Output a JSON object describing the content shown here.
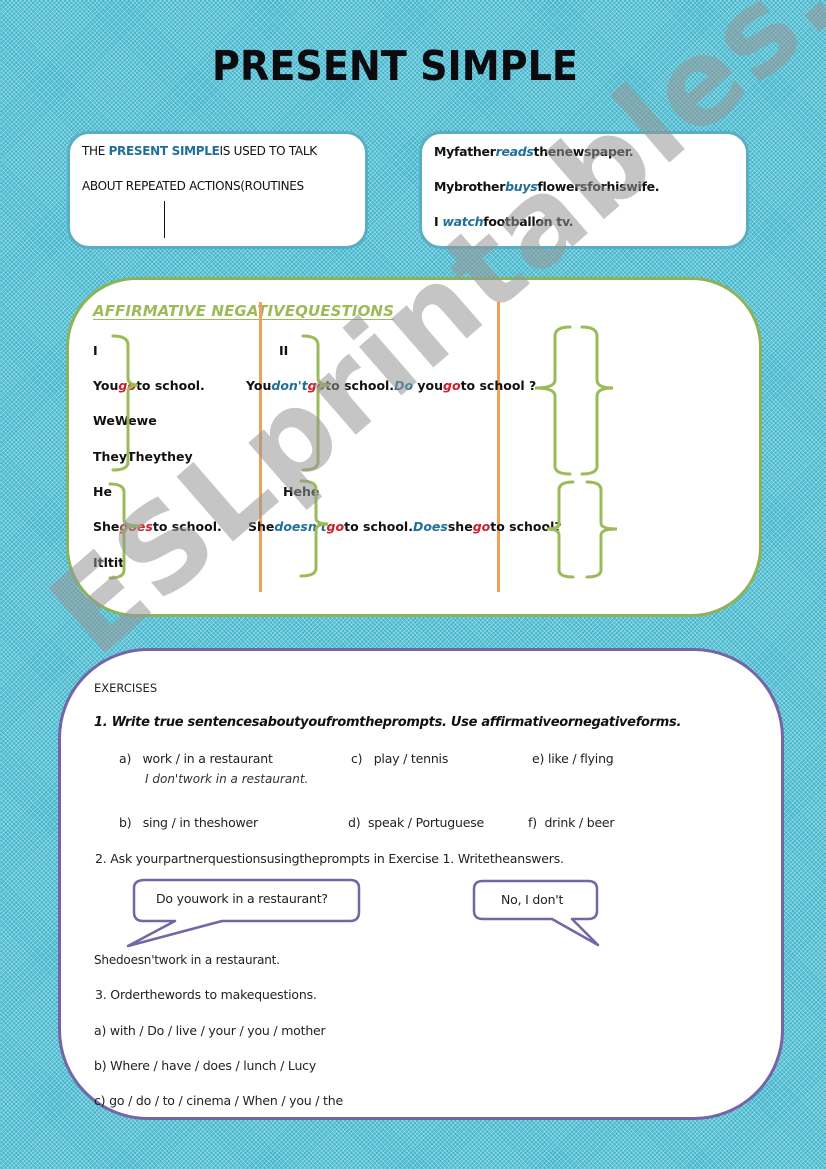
{
  "title": "PRESENT SIMPLE",
  "definition": {
    "prefix": "THE ",
    "highlight": "PRESENT SIMPLE",
    "line1_rest": "IS USED TO TALK",
    "line2": "ABOUT REPEATED ACTIONS(ROUTINES"
  },
  "examples": [
    {
      "before": "Myfather",
      "verb": "reads",
      "after": "thenewspaper."
    },
    {
      "before": "Mybrother",
      "verb": "buys",
      "after": "flowersforhiswife."
    },
    {
      "before": "I ",
      "verb": "watch",
      "after": "footballon tv."
    }
  ],
  "grammar": {
    "heading": "AFFIRMATIVE NEGATIVEQUESTIONS",
    "group1": {
      "pronouns": [
        "I",
        "WeWewe",
        "TheyTheythey"
      ],
      "neg_pronoun": "II",
      "affirmative": {
        "subject": "You",
        "verb": "go",
        "rest": "to school."
      },
      "negative": {
        "subject": "You",
        "aux": "don't",
        "verb": "go",
        "rest": "to school."
      },
      "question": {
        "aux": "Do",
        "subject": " you",
        "verb": "go",
        "rest": "to school ?"
      }
    },
    "group2": {
      "pronouns": [
        "He",
        "Itltit"
      ],
      "neg_pronoun": "Hehe",
      "affirmative": {
        "subject": "She",
        "verb": "goes",
        "rest": "to school."
      },
      "negative": {
        "subject": "She",
        "aux": "doesn't",
        "verb": "go",
        "rest": "to school."
      },
      "question": {
        "aux": "Does",
        "subject": "she",
        "verb": "go",
        "rest": "to school?"
      }
    },
    "colors": {
      "aux": "#1f6f9a",
      "verb": "#cc1d2a",
      "bracket": "#9bbb59",
      "divider": "#f0a05a"
    }
  },
  "exercises": {
    "header": "EXERCISES",
    "ex1": {
      "instruction": "1. Write true sentencesaboutyoufromtheprompts. Use affirmativeornegativeforms.",
      "items": [
        {
          "label": "a)",
          "prompt": "work / in a restaurant"
        },
        {
          "label": "c)",
          "prompt": "play / tennis"
        },
        {
          "label": "e)",
          "prompt": "like / flying"
        },
        {
          "label": "b)",
          "prompt": "sing / in theshower"
        },
        {
          "label": "d)",
          "prompt": "speak / Portuguese"
        },
        {
          "label": "f)",
          "prompt": "drink / beer"
        }
      ],
      "example_answer": "I don'twork in a restaurant."
    },
    "ex2": {
      "instruction": "2.  Ask yourpartnerquestionsusingtheprompts in Exercise 1. Writetheanswers.",
      "bubble_question": "Do youwork in a  restaurant?",
      "bubble_answer": "No, I don't",
      "example": "Shedoesn'twork in a restaurant."
    },
    "ex3": {
      "instruction": "3.  Orderthewords to makequestions.",
      "items": [
        "a)  with / Do / live / your / you / mother",
        "b) Where / have / does / lunch / Lucy",
        "c) go / do / to / cinema / When / you / the"
      ]
    }
  },
  "watermark": "ESLprintables.com"
}
